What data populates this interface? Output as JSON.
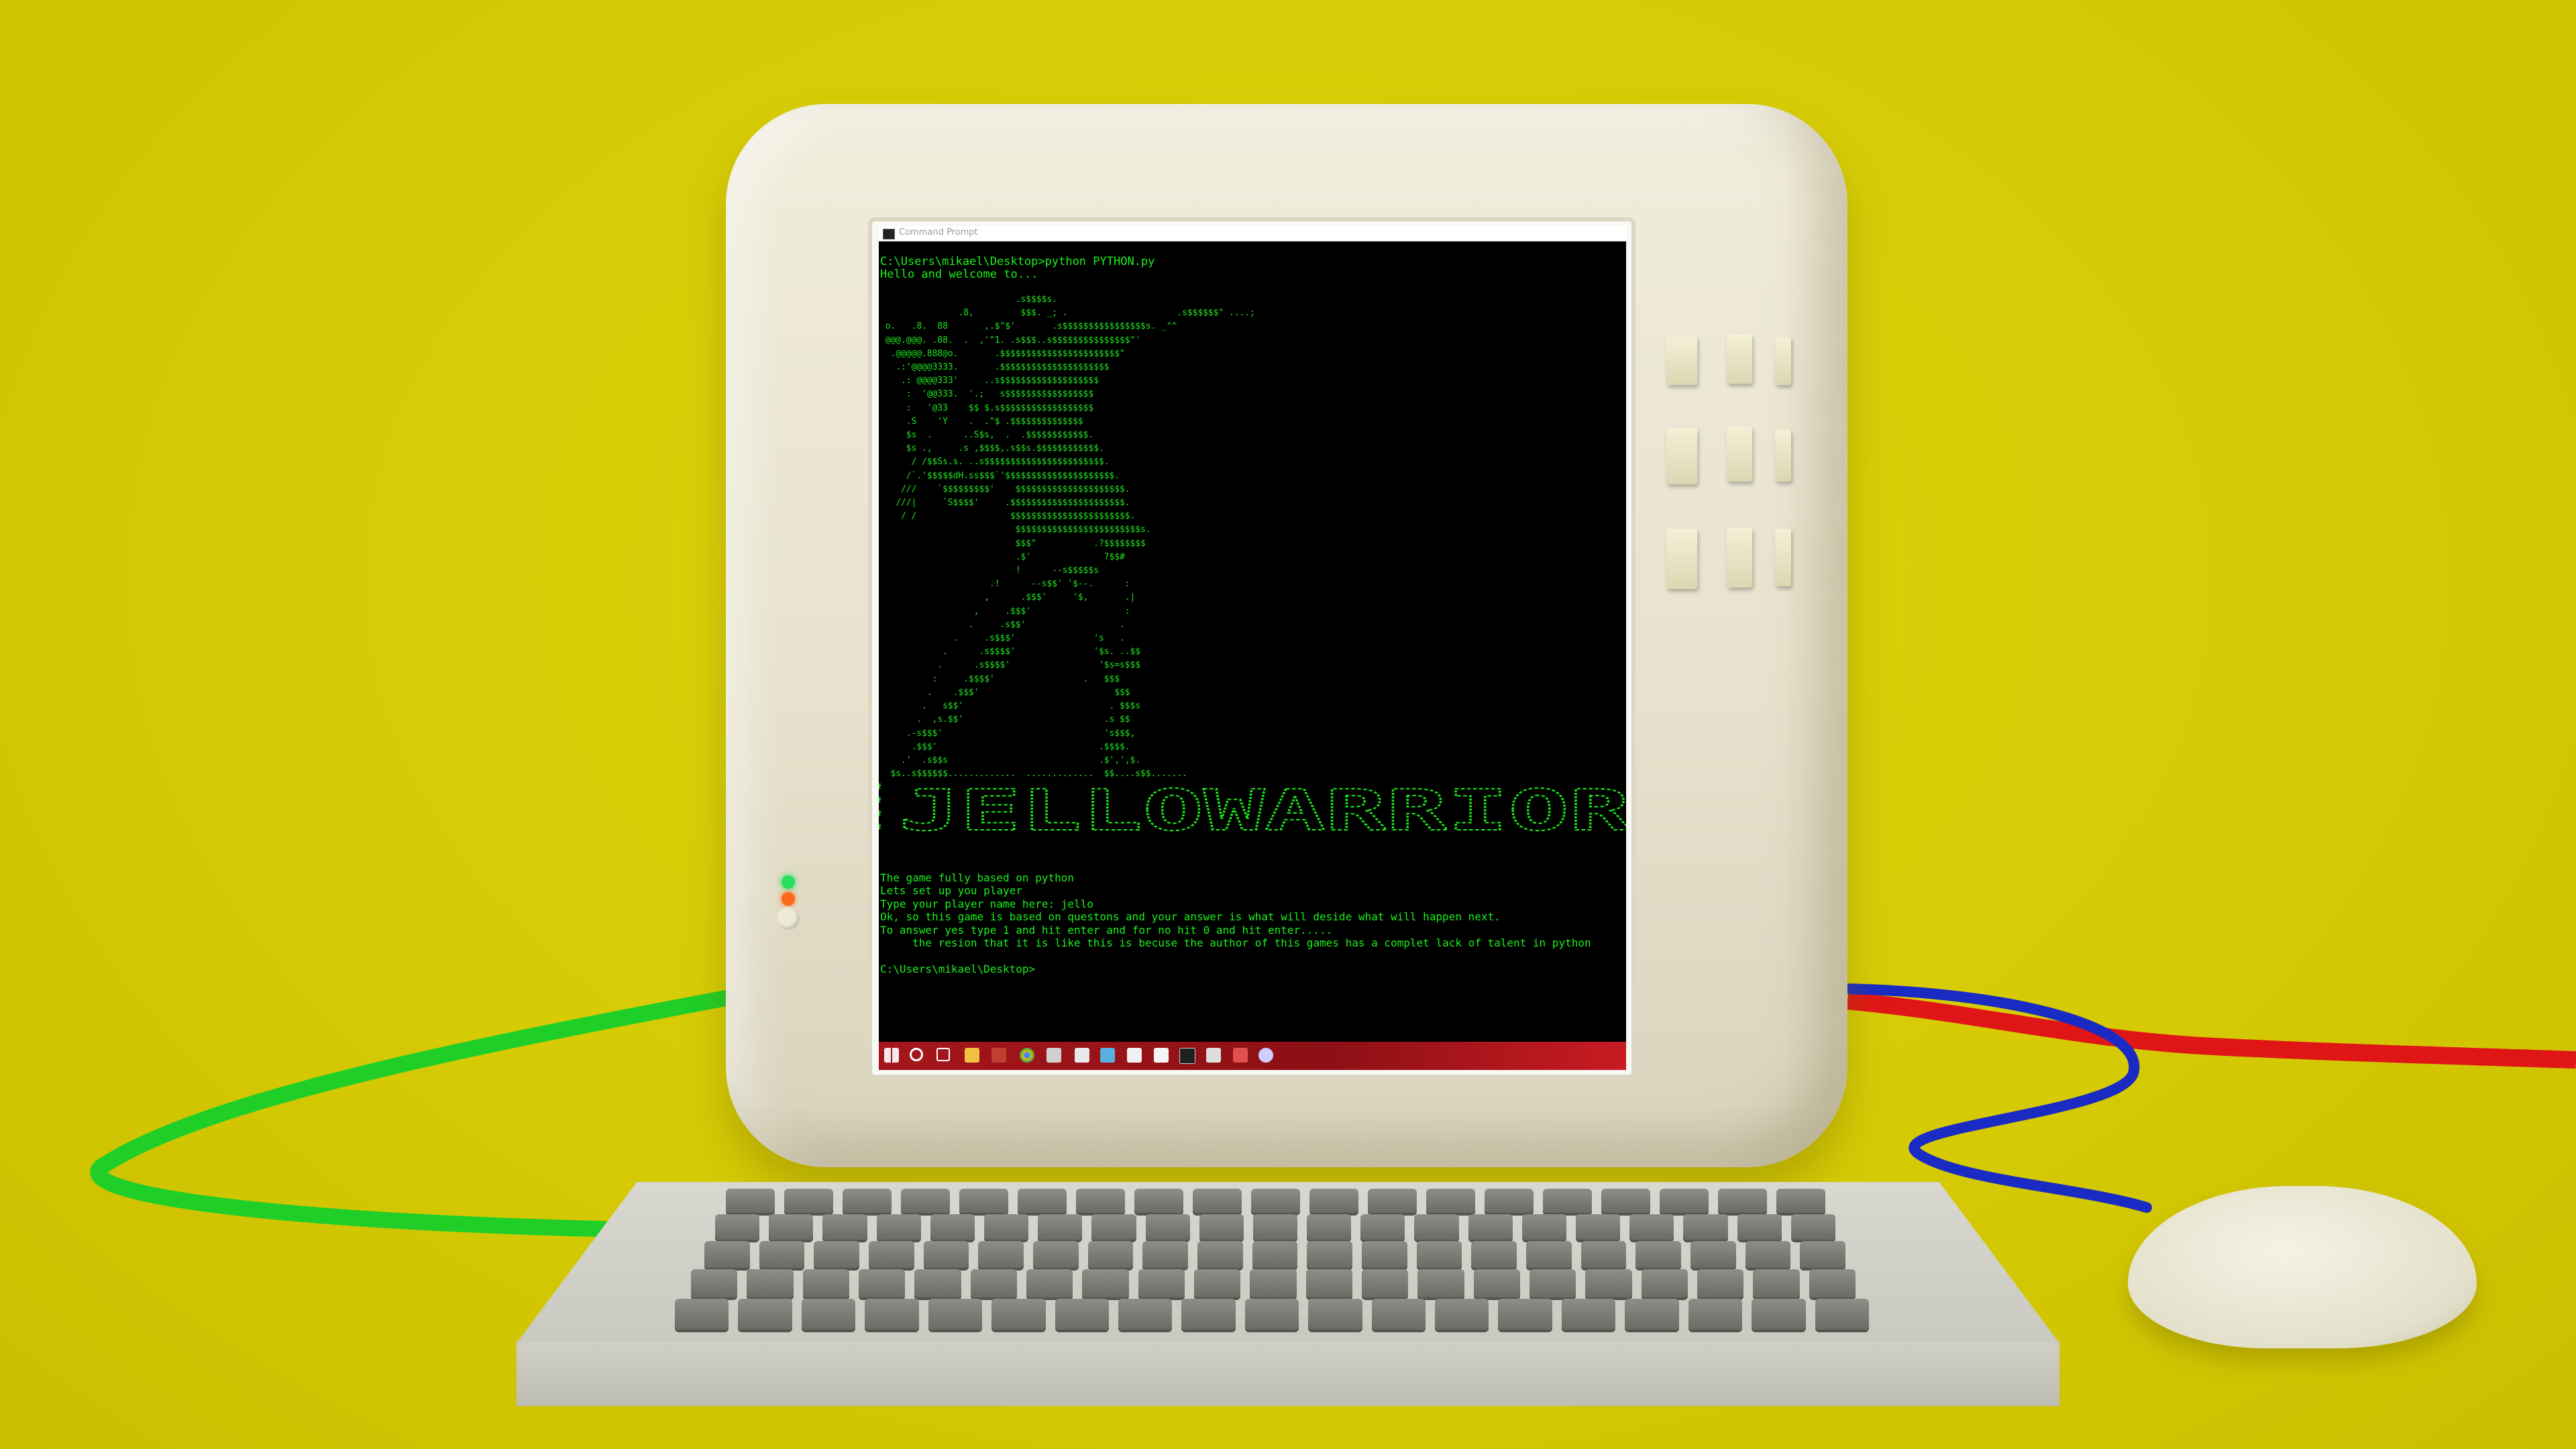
{
  "scene": {
    "description_colors": {
      "background": "#d6cb05",
      "monitor_body": "#e7e2cd",
      "console_text": "#1cf01c",
      "taskbar": "#a5161b",
      "cable_green": "#22d12a",
      "cable_blue": "#1a2bc4",
      "cable_red": "#e01616"
    }
  },
  "window": {
    "title": "Command Prompt"
  },
  "console": {
    "line1": "C:\\Users\\mikael\\Desktop>python PYTHON.py",
    "line2": "Hello and welcome to...",
    "ascii_art": "                          .s$$$$s.\n               .8,         $$$. _; .                     .s$$$$$$\" ....;\n o.   .8.  88       ,.$\"$'       .s$$$$$$$$$$$$$$$$s. _\"^\n @@@.@@@. .88.  .  ,'\"1. .s$$$..s$$$$$$$$$$$$$$$\"'\n  .@@@@@.888@o.       .$$$$$$$$$$$$$$$$$$$$$$$\"\n   .:'@@@@3333.       .$$$$$$$$$$$$$$$$$$$$$\n    .: @@@@333'     ..s$$$$$$$$$$$$$$$$$$$\n     :  '@@333.  '.;   s$$$$$$$$$$$$$$$$$\n     :   '@33    $$ $.s$$$$$$$$$$$$$$$$$$\n     .S    'Y    .  .\"$ .$$$$$$$$$$$$$$\n     $s  .      ..S$s,  .  .$$$$$$$$$$$$.\n     $s .,     .s ,$$$$,.s$$s.$$$$$$$$$$$$.\n      / /$$Ss.s. ..s$$$$$$$$$$$$$$$$$$$$$$$.\n     /`.'$$$$$dH.ss$$$`'$$$$$$$$$$$$$$$$$$$$$.\n    ///    `$$$$$$$$$'    $$$$$$$$$$$$$$$$$$$$$.\n   ///|     `S$$$$'     .$$$$$$$$$$$$$$$$$$$$$$.\n    / /                  $$$$$$$$$$$$$$$$$$$$$$$.\n                          $$$$$$$$$$$$$$$$$$$$$$$$s.\n                          $$$\"           .?$$$$$$$$\n                          .$'              ?$$#\n                          !      --s$$$$$s\n                     .!      --s$$' '$--.      :\n                    ,      .$$$'     '$,       .|\n                  ,     .$$$'                  :\n                 .     .s$$'                  .\n              .     .s$$$'               's   .\n            .      .s$$$$'               '$s. ..$$\n           .      .s$$$$'                 '$s=s$$$\n          :     .$$$$'                 .   $$$\n         .    .$$$'                          $$$\n        .   s$$'                            . $$$s\n       .  ,s.$$'                           .s $$\n     .-s$$$'                               's$$$,\n      .$$$'                               .$$$$.\n    .'  .s$$s                             .$',',$.\n  $s..s$$$$$$.............  .............  $$....s$$.......",
    "banner": "JELLOWARRIOR",
    "lower_lines": [
      "The game fully based on python",
      "Lets set up you player",
      "Type your player name here: jello",
      "Ok, so this game is based on questons and your answer is what will deside what will happen next.",
      "To answer yes type 1 and hit enter and for no hit 0 and hit enter.....",
      "     the resion that it is like this is becuse the author of this games has a complet lack of talent in python",
      "",
      "C:\\Users\\mikael\\Desktop>"
    ]
  },
  "taskbar": {
    "icons": [
      "windows-start-icon",
      "search-icon",
      "task-view-icon",
      "file-explorer-icon",
      "app-icon",
      "chrome-icon",
      "app-icon",
      "app-icon",
      "app-icon",
      "app-icon",
      "app-icon",
      "app-icon",
      "app-icon",
      "app-icon",
      "app-icon"
    ]
  }
}
